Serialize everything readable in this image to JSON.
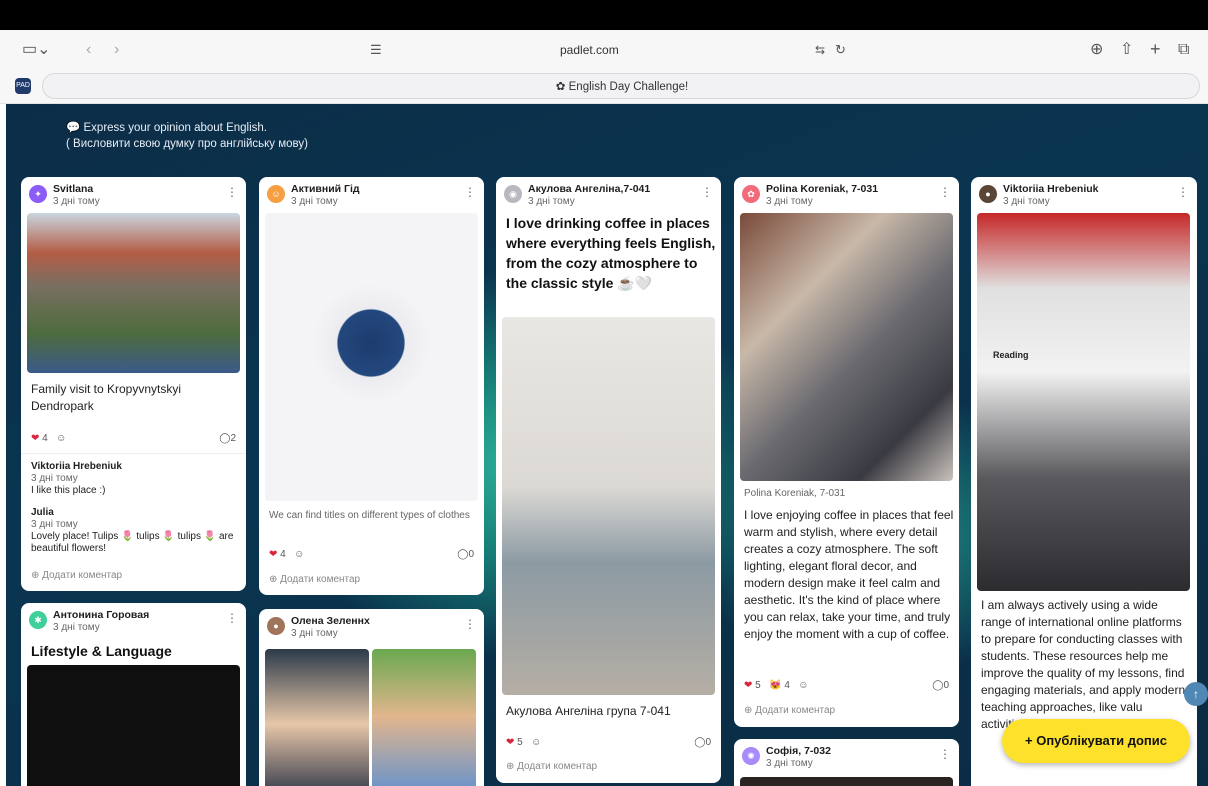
{
  "browser": {
    "url": "padlet.com",
    "tab_title": "English Day Challenge!",
    "favicon_text": "PAD"
  },
  "board": {
    "description_line1": "Express your opinion about English.",
    "description_line2": "( Висловити свою думку про англійську мову)"
  },
  "actions": {
    "add_comment": "Додати коментар",
    "publish": "Опублікувати допис"
  },
  "posts": [
    {
      "author": "Svitlana",
      "time": "3 дні тому",
      "body": "Family visit to Kropyvnytskyi Dendropark",
      "likes": "4",
      "comments": "2",
      "comment_list": [
        {
          "author": "Viktoriia Hrebeniuk",
          "time": "3 дні тому",
          "text": "I like this place :)"
        },
        {
          "author": "Julia",
          "time": "3 дні тому",
          "text": "Lovely place! Tulips 🌷 tulips 🌷 tulips 🌷 are beautiful flowers!"
        }
      ]
    },
    {
      "author": "Активний Гід",
      "time": "3 дні тому",
      "caption": "We can find titles on different types of clothes",
      "likes": "4",
      "comments": "0"
    },
    {
      "author": "Акулова Ангеліна,7-041",
      "time": "3 дні тому",
      "title": "I love drinking coffee in places where everything feels English, from the cozy atmosphere to the classic style ☕🤍",
      "body": "Акулова Ангеліна група 7-041",
      "likes": "5",
      "comments": "0"
    },
    {
      "author": "Polina Koreniak, 7-031",
      "time": "3 дні тому",
      "caption": "Polina Koreniak, 7-031",
      "body": "I love enjoying coffee in places that feel warm and stylish, where every detail creates a cozy atmosphere. The soft lighting, elegant floral decor, and modern design make it feel calm and aesthetic. It's the kind of place where you can relax, take your time, and truly enjoy the moment with a cup of coffee.",
      "likes": "5",
      "second_reaction": "4",
      "comments": "0"
    },
    {
      "author": "Viktoriia Hrebeniuk",
      "time": "3 дні тому",
      "body": "I am always actively using a wide range of international online platforms to prepare for conducting classes with students. These resources help me improve the quality of my lessons, find engaging materials, and apply modern teaching approaches, like valu activities, and methodological",
      "screen_title": "Reading"
    },
    {
      "author": "Антонина Горовая",
      "time": "3 дні тому",
      "title": "Lifestyle & Language"
    },
    {
      "author": "Олена Зеленнх",
      "time": "3 дні тому"
    },
    {
      "author": "Софія, 7-032",
      "time": "3 дні тому"
    }
  ]
}
